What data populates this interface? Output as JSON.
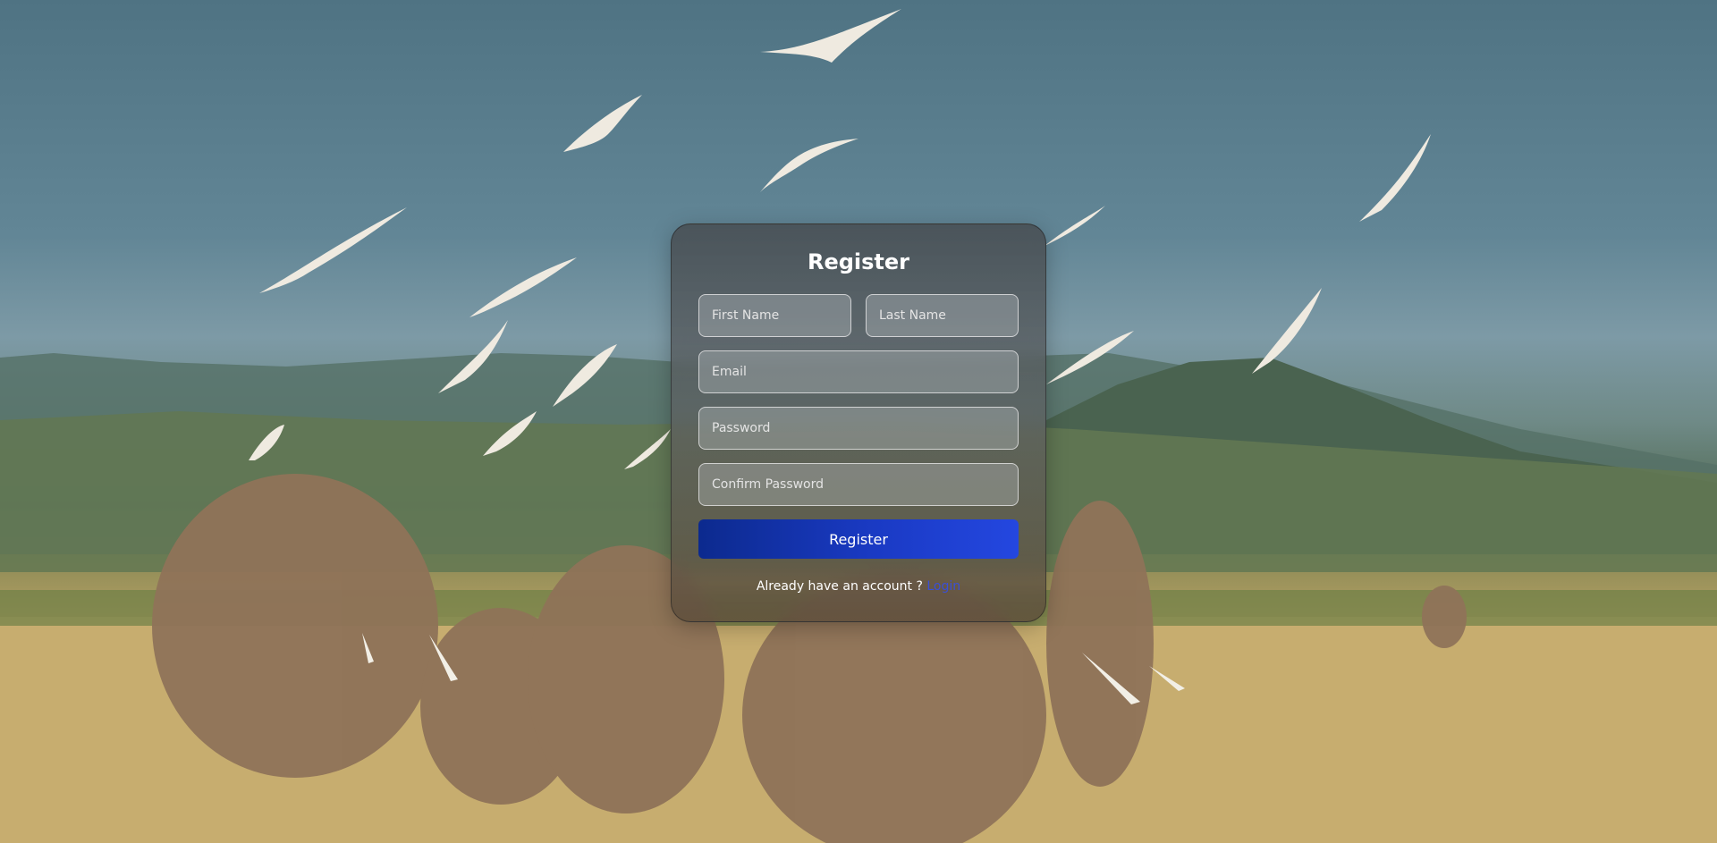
{
  "form": {
    "title": "Register",
    "first_name_placeholder": "First Name",
    "last_name_placeholder": "Last Name",
    "email_placeholder": "Email",
    "password_placeholder": "Password",
    "confirm_password_placeholder": "Confirm Password",
    "submit_label": "Register",
    "footer_text": "Already have an account ? ",
    "login_link": "Login"
  },
  "colors": {
    "button_start": "#0c2a8e",
    "button_end": "#2447e0",
    "link": "#3a4fd6",
    "title": "#ffffff"
  }
}
